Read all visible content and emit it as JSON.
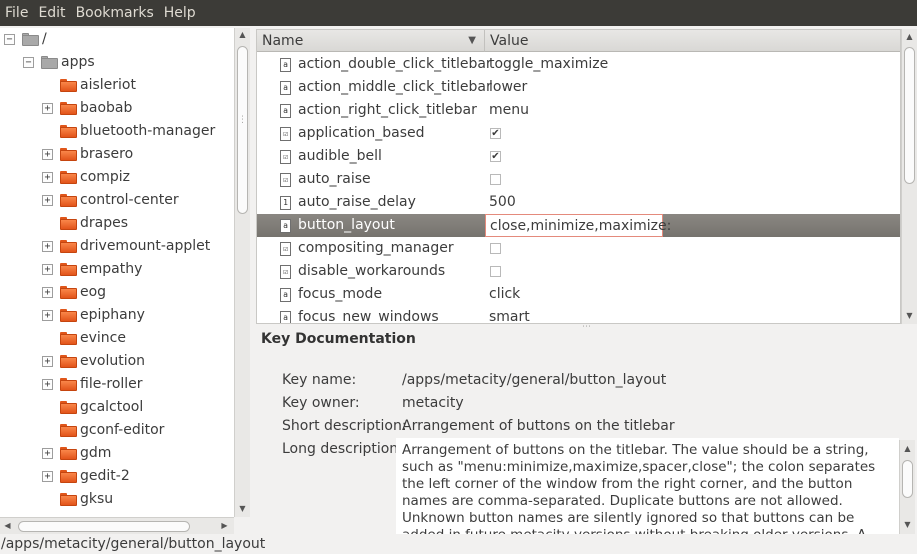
{
  "menubar": {
    "items": [
      "File",
      "Edit",
      "Bookmarks",
      "Help"
    ]
  },
  "tree": {
    "items": [
      {
        "label": "/",
        "expander": "−",
        "folder": "grey"
      },
      {
        "label": "apps",
        "expander": "−",
        "folder": "grey"
      },
      {
        "label": "aisleriot",
        "expander": "",
        "folder": "orange"
      },
      {
        "label": "baobab",
        "expander": "+",
        "folder": "orange"
      },
      {
        "label": "bluetooth-manager",
        "expander": "",
        "folder": "orange"
      },
      {
        "label": "brasero",
        "expander": "+",
        "folder": "orange"
      },
      {
        "label": "compiz",
        "expander": "+",
        "folder": "orange"
      },
      {
        "label": "control-center",
        "expander": "+",
        "folder": "orange"
      },
      {
        "label": "drapes",
        "expander": "",
        "folder": "orange"
      },
      {
        "label": "drivemount-applet",
        "expander": "+",
        "folder": "orange"
      },
      {
        "label": "empathy",
        "expander": "+",
        "folder": "orange"
      },
      {
        "label": "eog",
        "expander": "+",
        "folder": "orange"
      },
      {
        "label": "epiphany",
        "expander": "+",
        "folder": "orange"
      },
      {
        "label": "evince",
        "expander": "",
        "folder": "orange"
      },
      {
        "label": "evolution",
        "expander": "+",
        "folder": "orange"
      },
      {
        "label": "file-roller",
        "expander": "+",
        "folder": "orange"
      },
      {
        "label": "gcalctool",
        "expander": "",
        "folder": "orange"
      },
      {
        "label": "gconf-editor",
        "expander": "",
        "folder": "orange"
      },
      {
        "label": "gdm",
        "expander": "+",
        "folder": "orange"
      },
      {
        "label": "gedit-2",
        "expander": "+",
        "folder": "orange"
      },
      {
        "label": "gksu",
        "expander": "",
        "folder": "orange"
      }
    ]
  },
  "keylist": {
    "headers": {
      "name": "Name",
      "value": "Value"
    },
    "rows": [
      {
        "name": "action_double_click_titlebar",
        "type": "a",
        "value": "toggle_maximize",
        "checked": null
      },
      {
        "name": "action_middle_click_titlebar",
        "type": "a",
        "value": "lower",
        "checked": null
      },
      {
        "name": "action_right_click_titlebar",
        "type": "a",
        "value": "menu",
        "checked": null
      },
      {
        "name": "application_based",
        "type": "☑",
        "value": "",
        "checked": true
      },
      {
        "name": "audible_bell",
        "type": "☑",
        "value": "",
        "checked": true
      },
      {
        "name": "auto_raise",
        "type": "☑",
        "value": "",
        "checked": false
      },
      {
        "name": "auto_raise_delay",
        "type": "1",
        "value": "500",
        "checked": null
      },
      {
        "name": "button_layout",
        "type": "a",
        "value": "close,minimize,maximize:",
        "checked": null,
        "selected": true
      },
      {
        "name": "compositing_manager",
        "type": "☑",
        "value": "",
        "checked": false
      },
      {
        "name": "disable_workarounds",
        "type": "☑",
        "value": "",
        "checked": false
      },
      {
        "name": "focus_mode",
        "type": "a",
        "value": "click",
        "checked": null
      },
      {
        "name": "focus_new_windows",
        "type": "a",
        "value": "smart",
        "checked": null
      }
    ]
  },
  "doc": {
    "title": "Key Documentation",
    "key_name_label": "Key name:",
    "key_name": "/apps/metacity/general/button_layout",
    "key_owner_label": "Key owner:",
    "key_owner": "metacity",
    "short_desc_label": "Short description:",
    "short_desc": "Arrangement of buttons on the titlebar",
    "long_desc_label": "Long description:",
    "long_desc": "Arrangement of buttons on the titlebar. The value should be a string, such as \"menu:minimize,maximize,spacer,close\"; the colon separates the left corner of the window from the right corner, and the button names are comma-separated. Duplicate buttons are not allowed. Unknown button names are silently ignored so that buttons can be added in future metacity versions without breaking older versions. A special spacer tag can be used"
  },
  "status": {
    "path": "/apps/metacity/general/button_layout"
  }
}
